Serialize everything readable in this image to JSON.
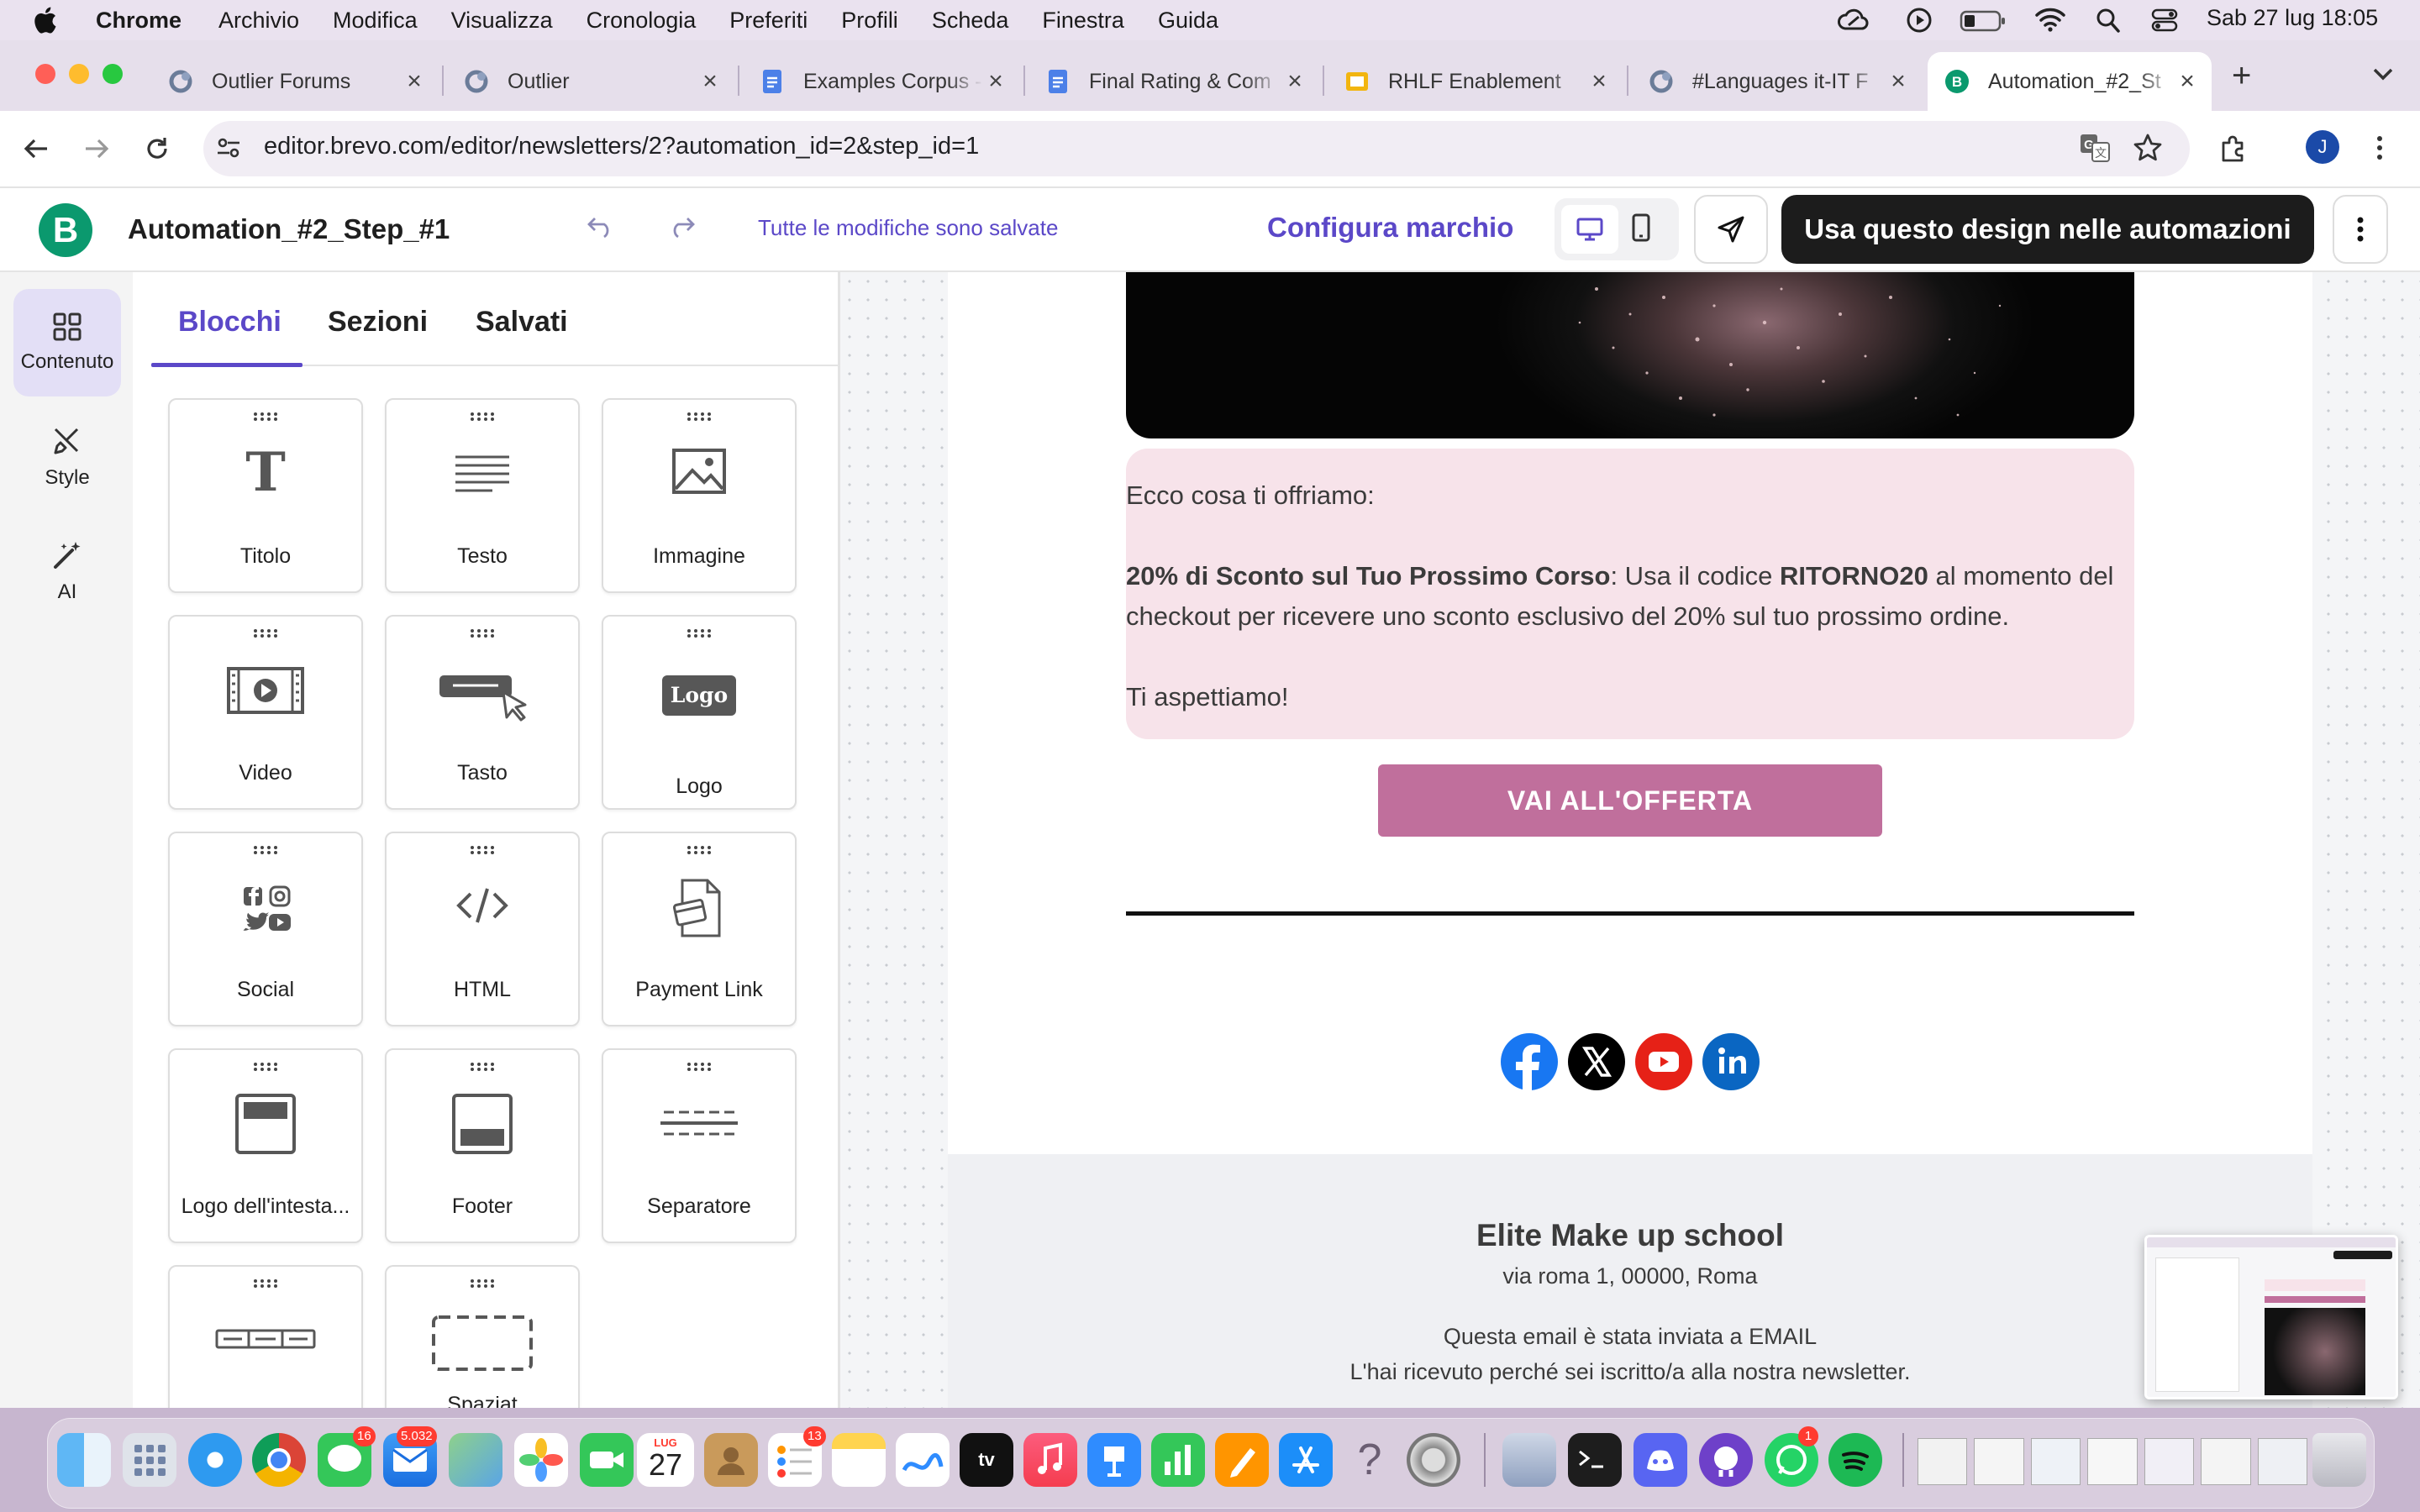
{
  "menubar": {
    "app": "Chrome",
    "items": [
      "Archivio",
      "Modifica",
      "Visualizza",
      "Cronologia",
      "Preferiti",
      "Profili",
      "Scheda",
      "Finestra",
      "Guida"
    ],
    "datetime": "Sab 27 lug  18:05"
  },
  "tabs": [
    {
      "label": "Outlier Forums",
      "icon": "outlier-icon"
    },
    {
      "label": "Outlier",
      "icon": "outlier-icon"
    },
    {
      "label": "Examples Corpus - ",
      "icon": "google-docs-icon"
    },
    {
      "label": "Final Rating & Com",
      "icon": "google-docs-icon"
    },
    {
      "label": "RHLF Enablement",
      "icon": "google-slides-icon"
    },
    {
      "label": "#Languages it-IT F",
      "icon": "outlier-icon"
    },
    {
      "label": "Automation_#2_St",
      "icon": "brevo-icon",
      "active": true
    }
  ],
  "address": {
    "url": "editor.brevo.com/editor/newsletters/2?automation_id=2&step_id=1",
    "profile_initial": "J"
  },
  "editor": {
    "logo_letter": "B",
    "title": "Automation_#2_Step_#1",
    "save_status": "Tutte le modifiche sono salvate",
    "brand_link": "Configura marchio",
    "primary_cta": "Usa questo design nelle automazioni",
    "accent": "#5b48c8"
  },
  "rail": [
    {
      "label": "Contenuto",
      "icon": "grid-icon",
      "active": true
    },
    {
      "label": "Style",
      "icon": "brush-icon"
    },
    {
      "label": "AI",
      "icon": "magic-wand-icon"
    }
  ],
  "panel": {
    "tabs": [
      "Blocchi",
      "Sezioni",
      "Salvati"
    ],
    "active_tab": "Blocchi",
    "blocks": [
      {
        "label": "Titolo",
        "icon": "title-t-icon"
      },
      {
        "label": "Testo",
        "icon": "text-lines-icon"
      },
      {
        "label": "Immagine",
        "icon": "image-icon"
      },
      {
        "label": "Video",
        "icon": "video-icon"
      },
      {
        "label": "Tasto",
        "icon": "button-cursor-icon"
      },
      {
        "label": "Logo",
        "icon": "logo-badge-icon",
        "badge": "Logo"
      },
      {
        "label": "Social",
        "icon": "social-icons-icon"
      },
      {
        "label": "HTML",
        "icon": "code-icon"
      },
      {
        "label": "Payment Link",
        "icon": "payment-link-icon"
      },
      {
        "label": "Logo dell'intesta...",
        "icon": "header-logo-icon"
      },
      {
        "label": "Footer",
        "icon": "footer-icon"
      },
      {
        "label": "Separatore",
        "icon": "separator-icon"
      },
      {
        "label": "",
        "icon": "navigation-icon"
      },
      {
        "label": "Spaziat",
        "icon": "spacer-icon"
      }
    ]
  },
  "email": {
    "intro": "Ecco cosa ti offriamo:",
    "offer_bold": "20% di Sconto sul Tuo Prossimo Corso",
    "offer_mid": ": Usa il codice ",
    "code": "RITORNO20",
    "offer_end": " al momento del checkout per ricevere uno sconto esclusivo del 20% sul tuo prossimo ordine.",
    "closing": "Ti aspettiamo!",
    "button": "VAI ALL'OFFERTA",
    "button_color": "#c06f9c",
    "text_bg": "#f7e3ea",
    "social": [
      {
        "name": "facebook-icon",
        "color": "#1877f2"
      },
      {
        "name": "x-icon",
        "color": "#000000"
      },
      {
        "name": "youtube-icon",
        "color": "#ff0000"
      },
      {
        "name": "linkedin-icon",
        "color": "#0a66c2"
      }
    ],
    "footer": {
      "company": "Elite Make up school",
      "address": "via roma 1, 00000, Roma",
      "sent_to": "Questa email è stata inviata a EMAIL",
      "reason": "L'hai ricevuto perché sei iscritto/a alla nostra newsletter."
    }
  },
  "dock": {
    "apps": [
      "finder-icon",
      "launchpad-icon",
      "safari-icon",
      "chrome-icon",
      "messages-icon",
      "mail-icon",
      "maps-icon",
      "photos-icon",
      "facetime-icon",
      "calendar-icon",
      "contacts-icon",
      "reminders-icon",
      "notes-icon",
      "freeform-icon",
      "appletv-icon",
      "music-icon",
      "keynote-icon",
      "numbers-icon",
      "pages-icon",
      "appstore-icon",
      "help-icon",
      "system-settings-icon",
      "preview-icon",
      "terminal-icon",
      "discord-icon",
      "github-icon",
      "whatsapp-icon",
      "spotify-icon"
    ],
    "calendar_month": "LUG",
    "calendar_day": "27",
    "badges": {
      "messages": "16",
      "mail": "5.032",
      "reminders": "13",
      "whatsapp": "1"
    }
  }
}
